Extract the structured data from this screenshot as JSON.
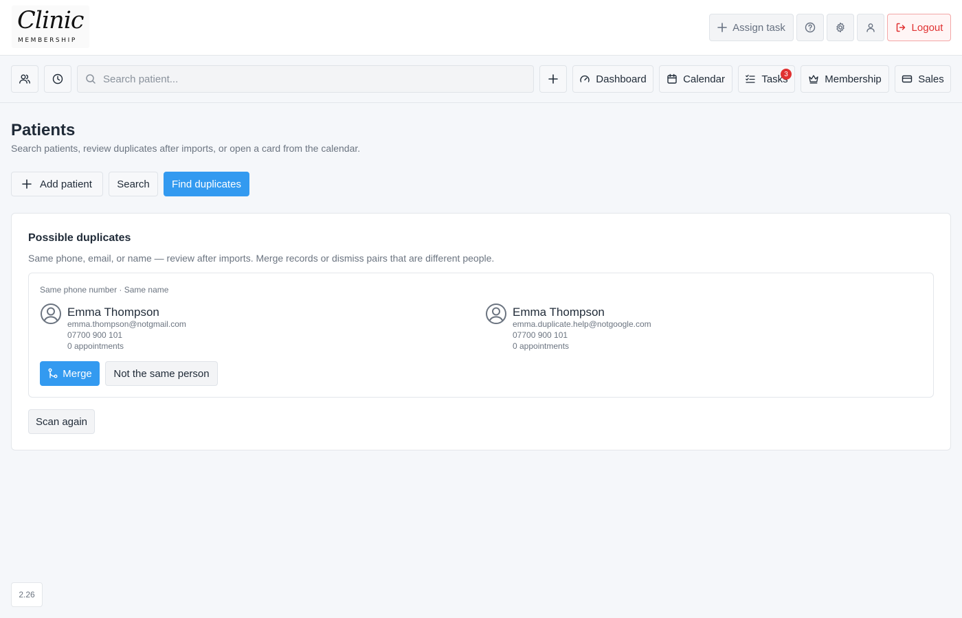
{
  "header": {
    "logo_script": "Clinic",
    "logo_sub": "MEMBERSHIP",
    "assign_task": "Assign task",
    "logout": "Logout"
  },
  "toolbar": {
    "search_placeholder": "Search patient...",
    "dashboard": "Dashboard",
    "calendar": "Calendar",
    "tasks": "Tasks",
    "tasks_badge": "3",
    "membership": "Membership",
    "sales": "Sales"
  },
  "page": {
    "title": "Patients",
    "subtitle": "Search patients, review duplicates after imports, or open a card from the calendar.",
    "add_patient": "Add patient",
    "search": "Search",
    "find_duplicates": "Find duplicates"
  },
  "duplicates": {
    "title": "Possible duplicates",
    "description": "Same phone, email, or name — review after imports. Merge records or dismiss pairs that are different people.",
    "pair": {
      "reason": "Same phone number · Same name",
      "left": {
        "name": "Emma Thompson",
        "email": "emma.thompson@notgmail.com",
        "phone": "07700 900 101",
        "appointments": "0 appointments"
      },
      "right": {
        "name": "Emma Thompson",
        "email": "emma.duplicate.help@notgoogle.com",
        "phone": "07700 900 101",
        "appointments": "0 appointments"
      },
      "merge": "Merge",
      "not_same": "Not the same person"
    },
    "scan_again": "Scan again"
  },
  "version": "2.26",
  "colors": {
    "accent": "#339af0",
    "danger": "#e03131",
    "background": "#f5f7fa"
  }
}
